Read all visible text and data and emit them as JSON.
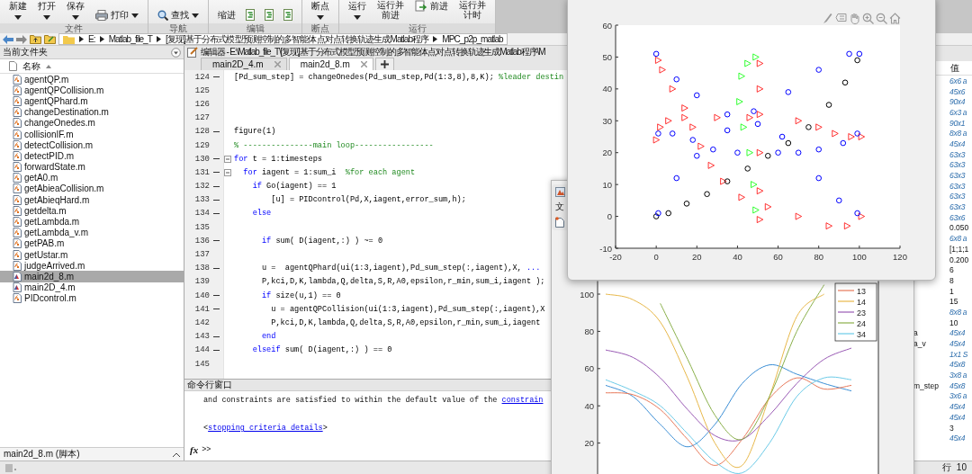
{
  "toolstrip": {
    "groups": [
      {
        "label": "文件",
        "buttons": [
          {
            "label": "新建",
            "kind": "split"
          },
          {
            "label": "打开",
            "kind": "split"
          },
          {
            "label": "保存",
            "kind": "split"
          },
          {
            "label": "打印",
            "kind": "print"
          }
        ]
      },
      {
        "label": "导航",
        "buttons": [
          {
            "label": "查找",
            "kind": "find"
          }
        ]
      },
      {
        "label": "编辑",
        "buttons": [
          {
            "label": "缩进",
            "kind": "indent"
          }
        ]
      },
      {
        "label": "断点",
        "buttons": [
          {
            "label": "断点",
            "kind": "split"
          }
        ]
      },
      {
        "label": "运行",
        "buttons": [
          {
            "label": "运行",
            "kind": "split"
          },
          {
            "label": "运行并前进",
            "kind": "plain"
          },
          {
            "label": "前进",
            "kind": "step"
          },
          {
            "label": "运行并计时",
            "kind": "plain"
          }
        ]
      }
    ]
  },
  "address_bar": {
    "segments": [
      "E:",
      "Matlab_file_T",
      "[复现]基于分布式模型预测控制的多智能体点对点转换轨迹生成Matlab程序",
      "MPC_p2p_matlab"
    ]
  },
  "current_folder": {
    "title": "当前文件夹",
    "column": "名称",
    "files": [
      {
        "name": "agentQP.m",
        "kind": "function",
        "selected": false
      },
      {
        "name": "agentQPCollision.m",
        "kind": "function",
        "selected": false
      },
      {
        "name": "agentQPhard.m",
        "kind": "function",
        "selected": false
      },
      {
        "name": "changeDestination.m",
        "kind": "function",
        "selected": false
      },
      {
        "name": "changeOnedes.m",
        "kind": "function",
        "selected": false
      },
      {
        "name": "collisionIF.m",
        "kind": "function",
        "selected": false
      },
      {
        "name": "detectCollision.m",
        "kind": "function",
        "selected": false
      },
      {
        "name": "detectPID.m",
        "kind": "function",
        "selected": false
      },
      {
        "name": "forwardState.m",
        "kind": "function",
        "selected": false
      },
      {
        "name": "getA0.m",
        "kind": "function",
        "selected": false
      },
      {
        "name": "getAbieaCollision.m",
        "kind": "function",
        "selected": false
      },
      {
        "name": "getAbieqHard.m",
        "kind": "function",
        "selected": false
      },
      {
        "name": "getdelta.m",
        "kind": "function",
        "selected": false
      },
      {
        "name": "getLambda.m",
        "kind": "function",
        "selected": false
      },
      {
        "name": "getLambda_v.m",
        "kind": "function",
        "selected": false
      },
      {
        "name": "getPAB.m",
        "kind": "function",
        "selected": false
      },
      {
        "name": "getUstar.m",
        "kind": "function",
        "selected": false
      },
      {
        "name": "judgeArrived.m",
        "kind": "function",
        "selected": false
      },
      {
        "name": "main2d_8.m",
        "kind": "script",
        "selected": true
      },
      {
        "name": "main2D_4.m",
        "kind": "script",
        "selected": false
      },
      {
        "name": "PIDcontrol.m",
        "kind": "function",
        "selected": false
      }
    ],
    "details": "main2d_8.m  (脚本)"
  },
  "editor": {
    "title": "编辑器 - E:\\Matlab_file_T\\[复现]基于分布式模型预测控制的多智能体点对点转换轨迹生成Matlab程序\\M",
    "tabs": [
      {
        "label": "main2D_4.m",
        "selected": false
      },
      {
        "label": "main2d_8.m",
        "selected": true
      }
    ],
    "lines": [
      {
        "number": "124",
        "executable": true,
        "foldable": false,
        "segments": [
          {
            "kind": "code",
            "text": "[Pd_sum_step] = changeOnedes(Pd_sum_step,Pd(1:3,8),8,K); "
          },
          {
            "kind": "comment",
            "text": "%leader destin"
          }
        ]
      },
      {
        "number": "125",
        "executable": false,
        "foldable": false
      },
      {
        "number": "126",
        "executable": false,
        "foldable": false
      },
      {
        "number": "127",
        "executable": false,
        "foldable": false
      },
      {
        "number": "128",
        "executable": true,
        "foldable": false,
        "segments": [
          {
            "kind": "code",
            "text": "figure(1)"
          }
        ]
      },
      {
        "number": "129",
        "executable": false,
        "foldable": false,
        "segments": [
          {
            "kind": "comment",
            "text": "% ---------------main loop-----------------"
          }
        ]
      },
      {
        "number": "130",
        "executable": true,
        "foldable": true,
        "segments": [
          {
            "kind": "keyword",
            "text": "for"
          },
          {
            "kind": "code",
            "text": " t = 1:timesteps"
          }
        ]
      },
      {
        "number": "131",
        "executable": true,
        "foldable": true,
        "segments": [
          {
            "kind": "keyword",
            "text": "  for"
          },
          {
            "kind": "code",
            "text": " iagent = 1:sum_i  "
          },
          {
            "kind": "comment",
            "text": "%for each agent"
          }
        ]
      },
      {
        "number": "132",
        "executable": true,
        "foldable": false,
        "segments": [
          {
            "kind": "keyword",
            "text": "    if"
          },
          {
            "kind": "code",
            "text": " Go(iagent) == 1"
          }
        ]
      },
      {
        "number": "133",
        "executable": true,
        "foldable": false,
        "segments": [
          {
            "kind": "code",
            "text": "        [u] = PIDcontrol(Pd,X,iagent,error_sum,h);"
          }
        ]
      },
      {
        "number": "134",
        "executable": true,
        "foldable": false,
        "segments": [
          {
            "kind": "keyword",
            "text": "    else"
          }
        ]
      },
      {
        "number": "135",
        "executable": false,
        "foldable": false
      },
      {
        "number": "136",
        "executable": true,
        "foldable": false,
        "segments": [
          {
            "kind": "keyword",
            "text": "      if"
          },
          {
            "kind": "code",
            "text": " sum( D(iagent,:) ) ~= 0"
          }
        ]
      },
      {
        "number": "137",
        "executable": false,
        "foldable": false
      },
      {
        "number": "138",
        "executable": true,
        "foldable": false,
        "segments": [
          {
            "kind": "code",
            "text": "      u =  agentQPhard(ui(1:3,iagent),Pd_sum_step(:,iagent),X, "
          },
          {
            "kind": "keyword",
            "text": "..."
          }
        ]
      },
      {
        "number": "139",
        "executable": false,
        "foldable": false,
        "segments": [
          {
            "kind": "code",
            "text": "      P,kci,D,K,lambda,Q,delta,S,R,A0,epsilon,r_min,sum_i,iagent );"
          }
        ]
      },
      {
        "number": "140",
        "executable": true,
        "foldable": false,
        "segments": [
          {
            "kind": "keyword",
            "text": "      if"
          },
          {
            "kind": "code",
            "text": " size(u,1) == 0"
          }
        ]
      },
      {
        "number": "141",
        "executable": true,
        "foldable": false,
        "segments": [
          {
            "kind": "code",
            "text": "        u = agentQPCollision(ui(1:3,iagent),Pd_sum_step(:,iagent),X"
          }
        ]
      },
      {
        "number": "142",
        "executable": false,
        "foldable": false,
        "segments": [
          {
            "kind": "code",
            "text": "        P,kci,D,K,lambda,Q,delta,S,R,A0,epsilon,r_min,sum_i,iagent"
          }
        ]
      },
      {
        "number": "143",
        "executable": true,
        "foldable": false,
        "segments": [
          {
            "kind": "keyword",
            "text": "      end"
          }
        ]
      },
      {
        "number": "144",
        "executable": true,
        "foldable": false,
        "segments": [
          {
            "kind": "keyword",
            "text": "    elseif"
          },
          {
            "kind": "code",
            "text": " sum( D(iagent,:) ) == 0"
          }
        ]
      },
      {
        "number": "145",
        "executable": false,
        "foldable": false
      }
    ]
  },
  "command_window": {
    "title": "命令行窗口",
    "lines": [
      {
        "text": "and constraints are satisfied to within the default value of the ",
        "link": "constrain"
      },
      {
        "text": "<",
        "link": "stopping criteria details",
        "after": ">"
      }
    ],
    "prompt_icon": "fx",
    "prompt": ">>"
  },
  "workspace": {
    "column": "值",
    "rows": [
      {
        "value": "6x6 a",
        "kind": "array"
      },
      {
        "value": "45x6",
        "kind": "array"
      },
      {
        "value": "90x4",
        "kind": "array"
      },
      {
        "value": "6x3 a",
        "kind": "array"
      },
      {
        "value": "90x1",
        "kind": "array"
      },
      {
        "value": "8x8 a",
        "kind": "array"
      },
      {
        "value": "45x4",
        "kind": "array"
      },
      {
        "value": "63x3",
        "kind": "array"
      },
      {
        "value": "63x3",
        "kind": "array"
      },
      {
        "value": "63x3",
        "kind": "array"
      },
      {
        "value": "63x3",
        "kind": "array"
      },
      {
        "value": "63x3",
        "kind": "array"
      },
      {
        "value": "63x3",
        "kind": "array"
      },
      {
        "value": "63x6",
        "kind": "array"
      },
      {
        "value": "0.050",
        "kind": "scalar"
      },
      {
        "value": "6x8 a",
        "kind": "array"
      },
      {
        "value": "[1;1;1",
        "kind": "scalar"
      },
      {
        "value": "0.200",
        "kind": "scalar"
      },
      {
        "value": "6",
        "kind": "scalar"
      },
      {
        "value": "8",
        "kind": "scalar"
      },
      {
        "value": "1",
        "kind": "scalar"
      },
      {
        "value": "15",
        "kind": "scalar"
      },
      {
        "value": "8x8 a",
        "kind": "array"
      },
      {
        "value": "10",
        "kind": "scalar"
      },
      {
        "name": "a",
        "value": "45x4",
        "kind": "array"
      },
      {
        "name": "a_v",
        "value": "45x4",
        "kind": "array"
      },
      {
        "value": "1x1 S",
        "kind": "array"
      },
      {
        "value": "45x8",
        "kind": "array"
      },
      {
        "value": "3x8 a",
        "kind": "array"
      },
      {
        "name": "m_step",
        "value": "45x8",
        "kind": "array"
      },
      {
        "value": "3x6 a",
        "kind": "array"
      },
      {
        "value": "45x4",
        "kind": "array"
      },
      {
        "value": "45x4",
        "kind": "array"
      },
      {
        "value": "3",
        "kind": "scalar"
      },
      {
        "value": "45x4",
        "kind": "array"
      }
    ]
  },
  "status_bar": {
    "position": "行  10"
  },
  "figure_front": {
    "chart_data": {
      "type": "scatter",
      "xlim": [
        -20,
        120
      ],
      "ylim": [
        -10,
        60
      ],
      "xticks": [
        -20,
        0,
        20,
        40,
        60,
        80,
        100,
        120
      ],
      "yticks": [
        -10,
        0,
        10,
        20,
        30,
        40,
        50,
        60
      ],
      "series": [
        {
          "color": "#ff0000",
          "marker": "triangle",
          "x": [
            1,
            3,
            8,
            14,
            18,
            22,
            27,
            33,
            42,
            55,
            70,
            85,
            94,
            101
          ],
          "values": [
            49,
            46,
            40,
            34,
            28,
            22,
            16,
            11,
            6,
            3,
            0,
            -3,
            -3,
            0
          ]
        },
        {
          "color": "#ff0000",
          "marker": "triangle",
          "x": [
            0,
            2,
            6,
            14,
            30,
            46,
            70,
            80,
            88,
            96,
            101
          ],
          "values": [
            24,
            28,
            30,
            31,
            31,
            31,
            30,
            28,
            26,
            25,
            25
          ]
        },
        {
          "color": "#ff0000",
          "marker": "triangle",
          "x": [
            51,
            51,
            51,
            51,
            51,
            51
          ],
          "values": [
            48,
            40,
            32,
            20,
            8,
            -1
          ]
        },
        {
          "color": "#00ff00",
          "marker": "triangle",
          "x": [
            49,
            45,
            42,
            41,
            43,
            46,
            48,
            49
          ],
          "values": [
            50,
            48,
            44,
            36,
            28,
            20,
            10,
            2
          ]
        },
        {
          "color": "#000000",
          "marker": "circle",
          "x": [
            0,
            6,
            15,
            25,
            35,
            45,
            55,
            65,
            75,
            85,
            93,
            99
          ],
          "values": [
            0,
            1,
            4,
            7,
            11,
            15,
            19,
            23,
            28,
            35,
            42,
            49
          ]
        },
        {
          "color": "#0000ff",
          "marker": "circle",
          "x": [
            0,
            10,
            20,
            35,
            50,
            62,
            70,
            80,
            90,
            99
          ],
          "values": [
            51,
            43,
            38,
            32,
            29,
            25,
            20,
            12,
            5,
            1
          ]
        },
        {
          "color": "#0000ff",
          "marker": "circle",
          "x": [
            1,
            8,
            18,
            28,
            40,
            60,
            80,
            92,
            99
          ],
          "values": [
            26,
            26,
            24,
            21,
            20,
            20,
            21,
            23,
            26
          ]
        },
        {
          "color": "#0000ff",
          "marker": "circle",
          "x": [
            1,
            10,
            20,
            35,
            48,
            65,
            80,
            95,
            100
          ],
          "values": [
            1,
            12,
            19,
            27,
            33,
            39,
            46,
            51,
            51
          ]
        }
      ]
    }
  },
  "figure_back": {
    "toolbar_label": "文",
    "chart_data": {
      "type": "line",
      "ylim": [
        3,
        107
      ],
      "yticks": [
        20,
        40,
        60,
        80,
        100
      ],
      "legend": true,
      "series": [
        {
          "color": "#3c8fd6",
          "values": [
            51,
            45,
            30,
            18,
            30,
            52,
            62,
            57,
            52,
            48
          ]
        },
        {
          "name": "13",
          "color": "#e8795a",
          "values": [
            47,
            46,
            38,
            22,
            8,
            22,
            44,
            55,
            49,
            51
          ]
        },
        {
          "name": "14",
          "color": "#e8b84a",
          "values": [
            100,
            97,
            85,
            55,
            20,
            8,
            45,
            88,
            100,
            null
          ]
        },
        {
          "name": "23",
          "color": "#9a5bb5",
          "values": [
            70,
            66,
            55,
            38,
            24,
            22,
            35,
            52,
            65,
            71
          ]
        },
        {
          "name": "24",
          "color": "#8ab04a",
          "values": [
            null,
            null,
            95,
            65,
            35,
            22,
            45,
            80,
            105,
            null
          ]
        },
        {
          "name": "34",
          "color": "#6ccbe8",
          "values": [
            54,
            48,
            40,
            25,
            10,
            4,
            20,
            45,
            55,
            54
          ]
        }
      ]
    }
  }
}
